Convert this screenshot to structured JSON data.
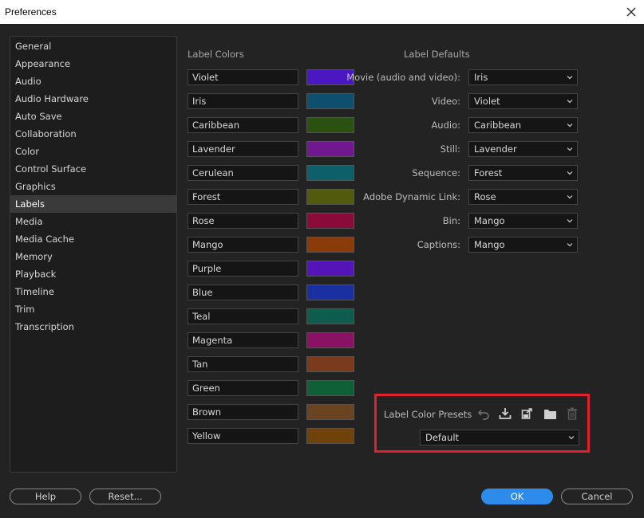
{
  "window": {
    "title": "Preferences"
  },
  "sidebar": {
    "items": [
      "General",
      "Appearance",
      "Audio",
      "Audio Hardware",
      "Auto Save",
      "Collaboration",
      "Color",
      "Control Surface",
      "Graphics",
      "Labels",
      "Media",
      "Media Cache",
      "Memory",
      "Playback",
      "Timeline",
      "Trim",
      "Transcription"
    ],
    "selected": "Labels"
  },
  "label_colors": {
    "title": "Label Colors",
    "items": [
      {
        "name": "Violet",
        "color": "#4a17c2"
      },
      {
        "name": "Iris",
        "color": "#0f4f6e"
      },
      {
        "name": "Caribbean",
        "color": "#2a510f"
      },
      {
        "name": "Lavender",
        "color": "#6f1890"
      },
      {
        "name": "Cerulean",
        "color": "#0d5f6a"
      },
      {
        "name": "Forest",
        "color": "#525a0d"
      },
      {
        "name": "Rose",
        "color": "#8a0b39"
      },
      {
        "name": "Mango",
        "color": "#8b3a0a"
      },
      {
        "name": "Purple",
        "color": "#5414b8"
      },
      {
        "name": "Blue",
        "color": "#1a30a0"
      },
      {
        "name": "Teal",
        "color": "#0d5c4e"
      },
      {
        "name": "Magenta",
        "color": "#8a1265"
      },
      {
        "name": "Tan",
        "color": "#7a3a1c"
      },
      {
        "name": "Green",
        "color": "#0f6036"
      },
      {
        "name": "Brown",
        "color": "#6a4420"
      },
      {
        "name": "Yellow",
        "color": "#6e420a"
      }
    ]
  },
  "label_defaults": {
    "title": "Label Defaults",
    "rows": [
      {
        "label": "Movie (audio and video):",
        "value": "Iris"
      },
      {
        "label": "Video:",
        "value": "Violet"
      },
      {
        "label": "Audio:",
        "value": "Caribbean"
      },
      {
        "label": "Still:",
        "value": "Lavender"
      },
      {
        "label": "Sequence:",
        "value": "Forest"
      },
      {
        "label": "Adobe Dynamic Link:",
        "value": "Rose"
      },
      {
        "label": "Bin:",
        "value": "Mango"
      },
      {
        "label": "Captions:",
        "value": "Mango"
      }
    ]
  },
  "presets": {
    "label": "Label Color Presets",
    "value": "Default",
    "icons": [
      "undo-icon",
      "import-icon",
      "export-icon",
      "folder-icon",
      "trash-icon"
    ],
    "highlight_color": "#e0202a"
  },
  "buttons": {
    "help": "Help",
    "reset": "Reset...",
    "ok": "OK",
    "cancel": "Cancel"
  },
  "colors": {
    "accent": "#2d8ceb",
    "background": "#232323"
  }
}
